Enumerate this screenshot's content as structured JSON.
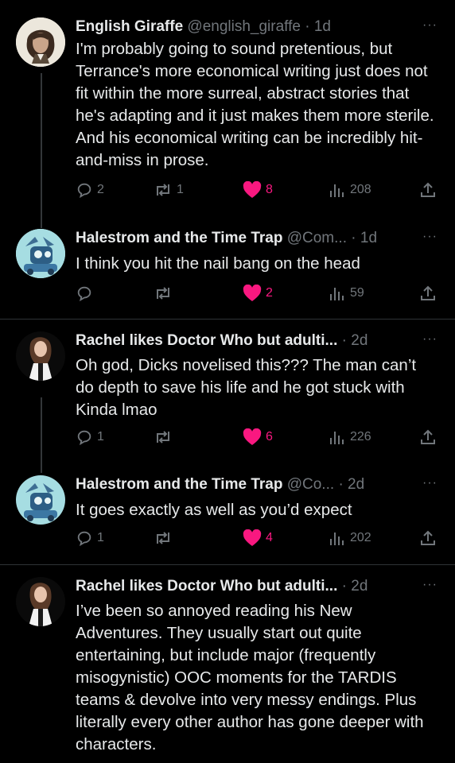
{
  "posts": [
    {
      "name": "English Giraffe",
      "handle": "@english_giraffe",
      "time": "· 1d",
      "text": "I'm probably going to sound pretentious, but Terrance's more economical writing just does not fit within the more surreal, abstract stories that he's adapting and it just makes them more sterile. And his economical writing can be incredibly hit-and-miss in prose.",
      "replies": "2",
      "reposts": "1",
      "likes": "8",
      "views": "208"
    },
    {
      "name": "Halestrom and the Time Trap",
      "handle": "@Com...",
      "time": "· 1d",
      "text": "I think you hit the nail bang on the head",
      "replies": "",
      "reposts": "",
      "likes": "2",
      "views": "59"
    },
    {
      "name": "Rachel likes Doctor Who but adulti...",
      "handle": "",
      "time": "· 2d",
      "text": "Oh god, Dicks novelised this??? The man can’t do depth to save his life and he got stuck with Kinda lmao",
      "replies": "1",
      "reposts": "",
      "likes": "6",
      "views": "226"
    },
    {
      "name": "Halestrom and the Time Trap",
      "handle": "@Co...",
      "time": "· 2d",
      "text": "It goes exactly as well as you’d expect",
      "replies": "1",
      "reposts": "",
      "likes": "4",
      "views": "202"
    },
    {
      "name": "Rachel likes Doctor Who but adulti...",
      "handle": "",
      "time": "· 2d",
      "text": "I’ve been so annoyed reading his New Adventures. They usually start out quite entertaining, but include major (frequently misogynistic) OOC moments for the TARDIS teams & devolve into very messy endings. Plus literally every other author has gone deeper with characters."
    }
  ],
  "more_label": "···",
  "colors": {
    "background": "#000000",
    "text": "#e7e9ea",
    "muted": "#71767b",
    "like": "#f91880",
    "divider": "#2f3336"
  },
  "icons": [
    "reply-icon",
    "repost-icon",
    "heart-icon",
    "views-icon",
    "share-icon",
    "more-icon"
  ]
}
